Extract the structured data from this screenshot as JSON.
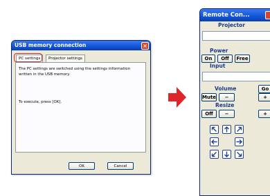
{
  "dialog": {
    "title": "USB memory connection",
    "tabs": [
      "PC settings",
      "Projector settings"
    ],
    "message": "The PC settings are switched using the settings information written in the USB memory.",
    "execute_hint": "To execute, press [OK].",
    "ok_label": "OK",
    "cancel_label": "Cancel"
  },
  "arrow": {
    "color": "#e0242c"
  },
  "remote": {
    "title": "Remote Con...",
    "projector_label": "Projector",
    "power_label": "Power",
    "power_buttons": [
      "On",
      "Off",
      "Free"
    ],
    "input_label": "Input",
    "go_label": "Go",
    "volume_label": "Volume",
    "mute_label": "Mute",
    "minus_label": "−",
    "plus_label": "+",
    "resize_label": "Resize",
    "resize_off_label": "Off",
    "nav_icons": [
      "arrow-up-left-icon",
      "arrow-up-icon",
      "arrow-up-right-icon",
      "arrow-left-icon",
      "arrow-right-icon",
      "arrow-down-left-icon",
      "arrow-down-icon",
      "arrow-down-right-icon"
    ]
  }
}
